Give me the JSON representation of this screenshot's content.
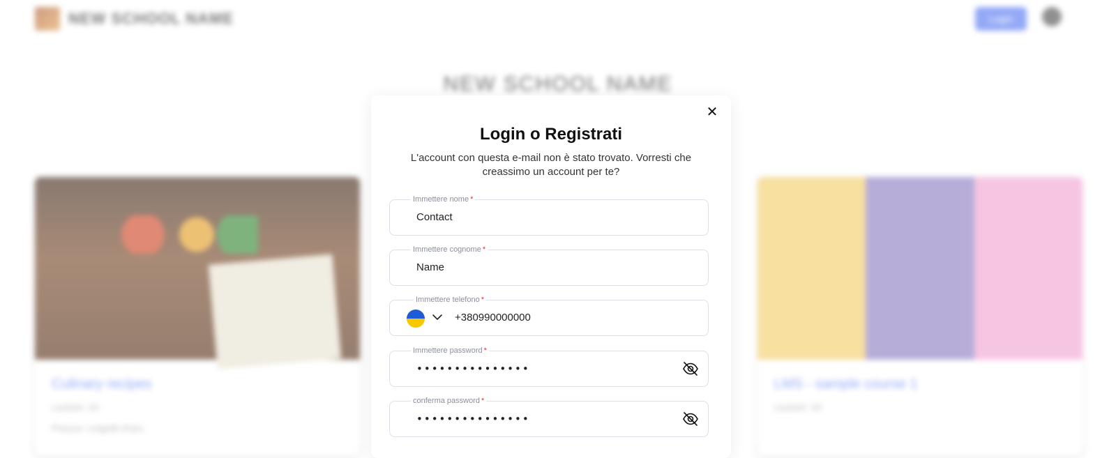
{
  "background": {
    "brand_name": "NEW SCHOOL NAME",
    "header_button_label": "Login",
    "page_title": "NEW SCHOOL NAME",
    "cards": [
      {
        "title": "Culinary recipes",
        "meta": "Lezioni: 10",
        "meta2": "Prezzo: Lingotti d'oro"
      },
      {
        "title": "LMS - sample course 1",
        "meta": "Lezioni: 10",
        "meta2": ""
      }
    ]
  },
  "modal": {
    "title": "Login o Registrati",
    "description": "L'account con questa e-mail non è stato trovato. Vorresti che creassimo un account per te?",
    "close_icon": "close-icon",
    "fields": {
      "first_name": {
        "label": "Immettere nome",
        "value": "Contact"
      },
      "last_name": {
        "label": "Immettere cognome",
        "value": "Name"
      },
      "phone": {
        "label": "Immettere telefono",
        "value": "+380990000000",
        "country_flag": "ukraine-flag-icon"
      },
      "password": {
        "label": "Immettere password",
        "value": "•••••••••••••••"
      },
      "confirm_password": {
        "label": "conferma password",
        "value": "•••••••••••••••"
      }
    },
    "required_mark": "*"
  },
  "colors": {
    "accent": "#5b7cf2",
    "required": "#e03131",
    "flag_blue": "#1e5bd6",
    "flag_yellow": "#f7c800"
  }
}
